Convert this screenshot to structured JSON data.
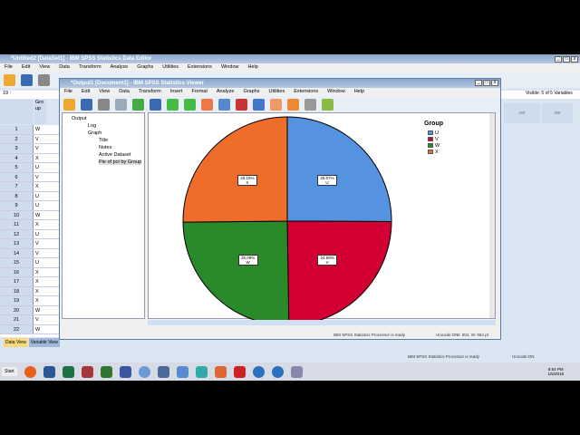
{
  "editor": {
    "title": "*Untitled2 [DataSet1] - IBM SPSS Statistics Data Editor",
    "menu": [
      "File",
      "Edit",
      "View",
      "Data",
      "Transform",
      "Analyze",
      "Graphs",
      "Utilities",
      "Extensions",
      "Window",
      "Help"
    ],
    "cell_ref": "19 :",
    "visible": "Visible: 5 of 5 Variables",
    "column": "Group",
    "var_headers": [
      "var",
      "var"
    ],
    "rows": [
      [
        "1",
        "W"
      ],
      [
        "2",
        "V"
      ],
      [
        "3",
        "V"
      ],
      [
        "4",
        "X"
      ],
      [
        "5",
        "U"
      ],
      [
        "6",
        "V"
      ],
      [
        "7",
        "X"
      ],
      [
        "8",
        "U"
      ],
      [
        "9",
        "U"
      ],
      [
        "10",
        "W"
      ],
      [
        "11",
        "X"
      ],
      [
        "12",
        "U"
      ],
      [
        "13",
        "V"
      ],
      [
        "14",
        "V"
      ],
      [
        "15",
        "U"
      ],
      [
        "16",
        "X"
      ],
      [
        "17",
        "X"
      ],
      [
        "18",
        "X"
      ],
      [
        "19",
        "X"
      ],
      [
        "20",
        "W"
      ],
      [
        "21",
        "V"
      ],
      [
        "22",
        "W"
      ]
    ],
    "tabs": [
      "Data View",
      "Variable View"
    ],
    "status": "IBM SPSS Statistics Processor is ready",
    "unicode": "Unicode:ON"
  },
  "viewer": {
    "title": "*Output1 [Document1] - IBM SPSS Statistics Viewer",
    "menu": [
      "File",
      "Edit",
      "View",
      "Data",
      "Transform",
      "Insert",
      "Format",
      "Analyze",
      "Graphs",
      "Utilities",
      "Extensions",
      "Window",
      "Help"
    ],
    "tree": [
      "Output",
      "Log",
      "Graph",
      "Title",
      "Notes",
      "Active Dataset",
      "Pie of pct by Group"
    ],
    "status": "IBM SPSS Statistics Processor is ready",
    "unicode": "Unicode:ON",
    "size": "H: 504, W: 654 pt"
  },
  "chart_data": {
    "type": "pie",
    "legend_title": "Group",
    "legend_placement": "top-right",
    "categories": [
      "U",
      "V",
      "W",
      "X"
    ],
    "values": [
      25.07,
      24.69,
      25.09,
      25.15
    ],
    "labels": [
      "25.07%",
      "24.69%",
      "25.09%",
      "25.15%"
    ],
    "colors": [
      "#5592e0",
      "#d20032",
      "#2a8a2a",
      "#f06c2a"
    ]
  },
  "taskbar": {
    "start": "Start",
    "time": "8:54 PM",
    "date": "1/6/2019"
  }
}
